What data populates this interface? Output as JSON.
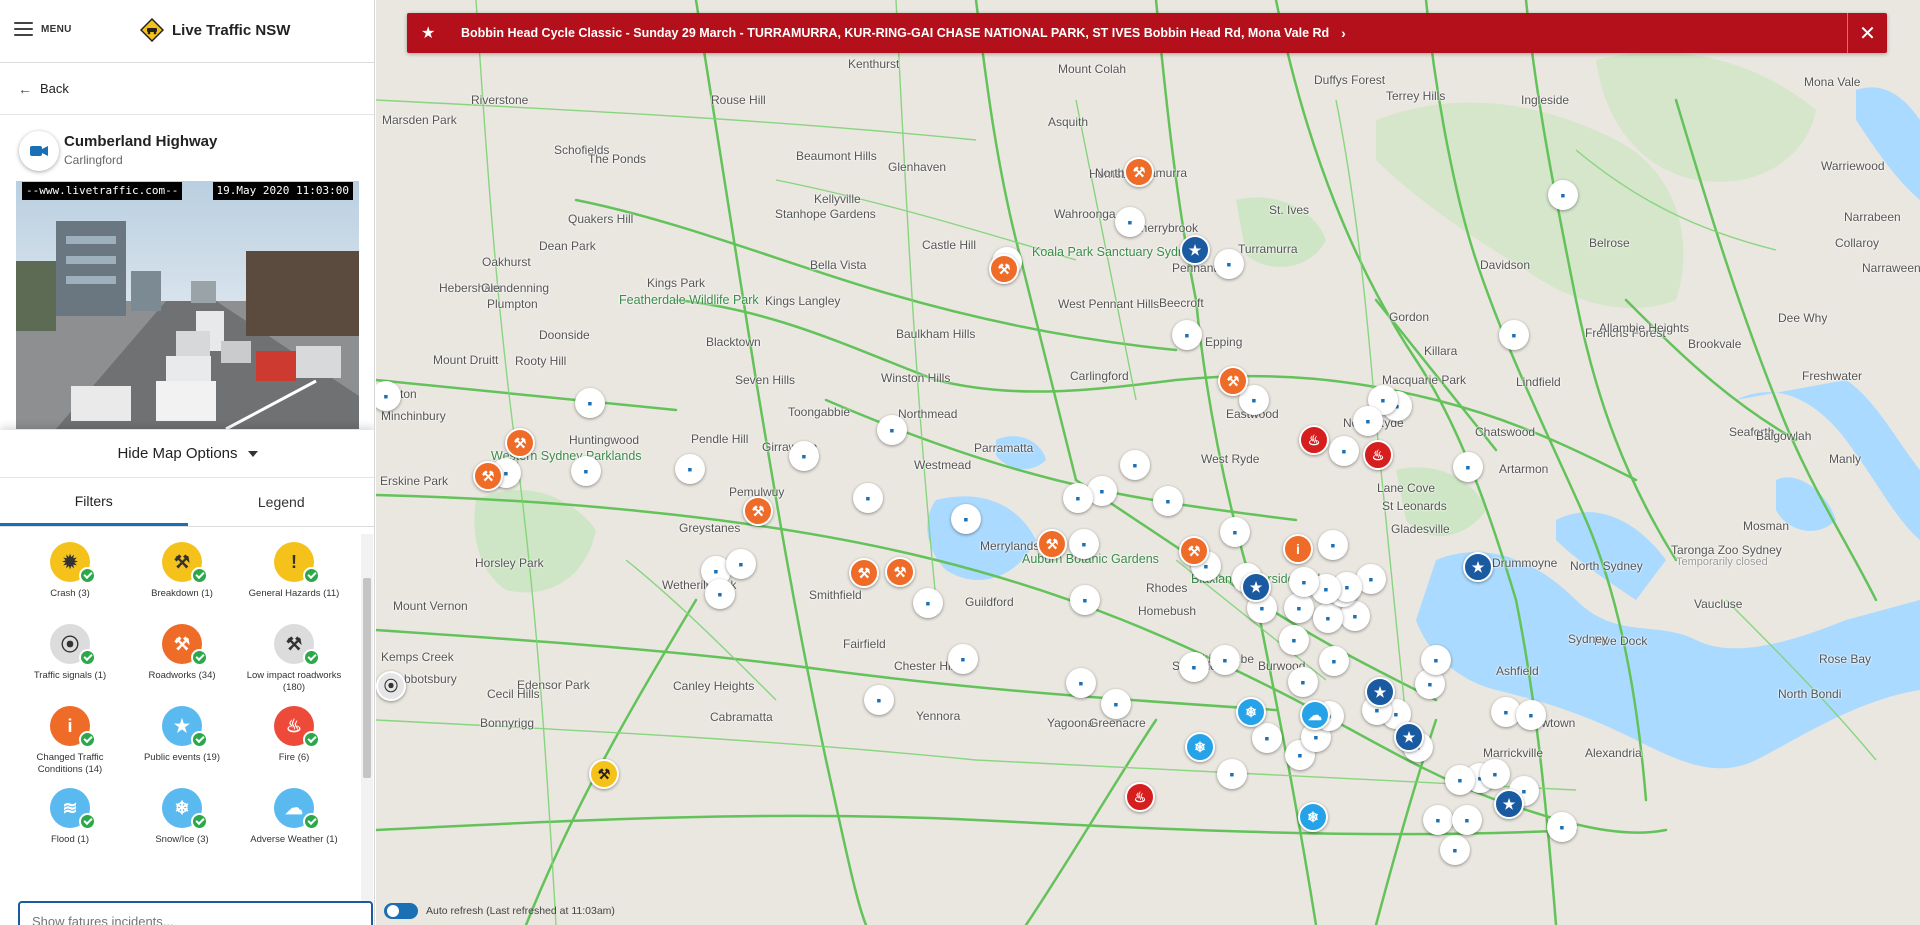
{
  "header": {
    "menu_label": "MENU",
    "brand_name": "Live Traffic NSW"
  },
  "nav": {
    "back_label": "Back"
  },
  "camera": {
    "title": "Cumberland Highway",
    "subtitle": "Carlingford",
    "stamp_site": "--www.livetraffic.com--",
    "stamp_time": "19.May 2020  11:03:00"
  },
  "map_options": {
    "toggle_label": "Hide Map Options",
    "tabs": [
      {
        "label": "Filters",
        "active": true
      },
      {
        "label": "Legend",
        "active": false
      }
    ],
    "search_placeholder": "Show fatures incidents...",
    "filters": [
      {
        "label": "Crash  (3)",
        "color": "#f5c11b",
        "icon": "crash-icon",
        "sym": "✹"
      },
      {
        "label": "Breakdown  (1)",
        "color": "#f5c11b",
        "icon": "breakdown-icon",
        "sym": "⚒"
      },
      {
        "label": "General Hazards  (11)",
        "color": "#f5c11b",
        "icon": "hazard-icon",
        "sym": "!"
      },
      {
        "label": "Traffic signals  (1)",
        "color": "#dcdcdc",
        "icon": "traffic-light-icon",
        "sym": "⦿"
      },
      {
        "label": "Roadworks  (34)",
        "color": "#ef6b28",
        "icon": "roadworks-icon",
        "sym": "⚒"
      },
      {
        "label": "Low impact roadworks (180)",
        "color": "#dcdcdc",
        "icon": "low-impact-roadworks-icon",
        "sym": "⚒"
      },
      {
        "label": "Changed Traffic Conditions  (14)",
        "color": "#ef6b28",
        "icon": "changed-conditions-icon",
        "sym": "i"
      },
      {
        "label": "Public events  (19)",
        "color": "#5ab9ef",
        "icon": "star-icon",
        "sym": "★"
      },
      {
        "label": "Fire  (6)",
        "color": "#ee4a3a",
        "icon": "fire-icon",
        "sym": "♨"
      },
      {
        "label": "Flood  (1)",
        "color": "#5ab9ef",
        "icon": "flood-icon",
        "sym": "≋"
      },
      {
        "label": "Snow/Ice  (3)",
        "color": "#5ab9ef",
        "icon": "snowflake-icon",
        "sym": "❄"
      },
      {
        "label": "Adverse Weather  (1)",
        "color": "#5ab9ef",
        "icon": "cloud-icon",
        "sym": "☁"
      }
    ]
  },
  "banner": {
    "text": "Bobbin Head Cycle Classic - Sunday 29 March - TURRAMURRA, KUR-RING-GAI CHASE NATIONAL PARK, ST IVES Bobbin Head Rd, Mona Vale Rd",
    "close_label": "✕"
  },
  "auto_refresh": {
    "label": "Auto refresh (Last refreshed at 11:03am)",
    "enabled": true
  },
  "map": {
    "places": [
      "Kenthurst",
      "Mount Colah",
      "Duffys Forest",
      "Mona Vale",
      "Terrey Hills",
      "Ingleside",
      "Riverstone",
      "Rouse Hill",
      "Marsden Park",
      "Beaumont Hills",
      "Schofields",
      "The Ponds",
      "Kellyville",
      "Glenhaven",
      "Asquith",
      "Hornsby",
      "North Turramurra",
      "Warriewood",
      "Narrabeen",
      "Quakers Hill",
      "Stanhope Gardens",
      "Cherrybrook",
      "Castle Hill",
      "Wahroonga",
      "St. Ives",
      "Narraween",
      "Collaroy",
      "Dean Park",
      "Oakhurst",
      "Bella Vista",
      "Kings Park",
      "Kings Langley",
      "Koala Park Sanctuary Sydney",
      "Pennant Hills",
      "Turramurra",
      "Davidson",
      "Belrose",
      "Hebersham",
      "Glendenning",
      "Plumpton",
      "Featherdale Wildlife Park",
      "West Pennant Hills",
      "Beecroft",
      "Frenchs Forest",
      "Dee Why",
      "Doonside",
      "Blacktown",
      "Baulkham Hills",
      "Gordon",
      "Allambie Heights",
      "Brookvale",
      "Mount Druitt",
      "Rooty Hill",
      "Seven Hills",
      "Winston Hills",
      "Carlingford",
      "Epping",
      "Killara",
      "Macquarie Park",
      "Lindfield",
      "Freshwater",
      "Colyton",
      "Toongabbie",
      "Northmead",
      "Eastwood",
      "North Ryde",
      "Chatswood",
      "Seaforth",
      "Balgowlah",
      "Minchinbury",
      "Huntingwood",
      "Western Sydney Parklands",
      "Girraween",
      "Pendle Hill",
      "Parramatta",
      "Westmead",
      "West Ryde",
      "Artarmon",
      "Manly",
      "Erskine Park",
      "Pemulwuy",
      "Blaxland Riverside Park",
      "Lane Cove",
      "St Leonards",
      "Greystanes",
      "Merrylands",
      "Gladesville",
      "Mosman",
      "Taronga Zoo Sydney",
      "Temporarily closed",
      "Horsley Park",
      "Auburn Botanic Gardens",
      "Drummoyne",
      "North Sydney",
      "Wetherill Park",
      "Smithfield",
      "Rhodes",
      "Homebush",
      "Mount Vernon",
      "Guildford",
      "Vaucluse",
      "Kemps Creek",
      "Fairfield",
      "Lidcombe",
      "Five Dock",
      "Sydney",
      "Abbotsbury",
      "Strathfield",
      "Burwood",
      "Rose Bay",
      "Edensor Park",
      "Chester Hill",
      "Yennora",
      "Ashfield",
      "Cecil Hills",
      "Canley Heights",
      "North Bondi",
      "Bonnyrigg",
      "Cabramatta",
      "Yagoona",
      "Greenacre",
      "Newtown",
      "Marrickville",
      "Alexandria"
    ]
  }
}
